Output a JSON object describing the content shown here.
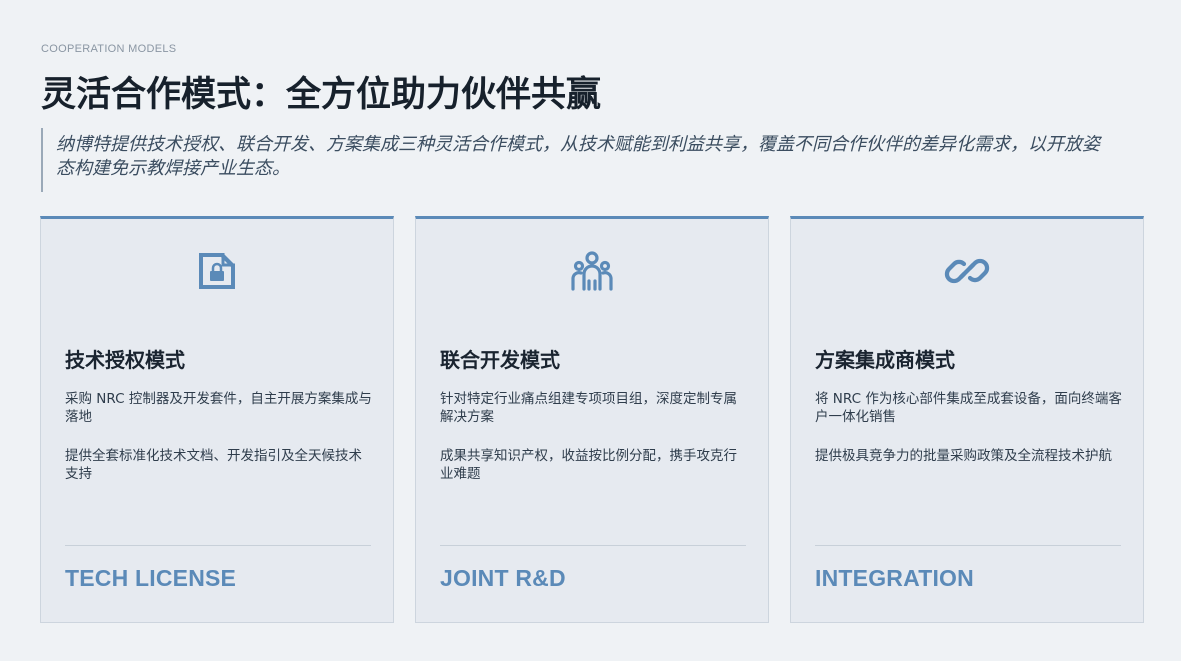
{
  "header": {
    "eyebrow": "COOPERATION MODELS",
    "title": "灵活合作模式：全方位助力伙伴共赢",
    "intro": "纳博特提供技术授权、联合开发、方案集成三种灵活合作模式，从技术赋能到利益共享，覆盖不同合作伙伴的差异化需求，以开放姿态构建免示教焊接产业生态。"
  },
  "colors": {
    "accent": "#5b8ab8",
    "background": "#eff2f5",
    "card": "#e6eaf0"
  },
  "cards": [
    {
      "icon": "license-document-icon",
      "title": "技术授权模式",
      "para1": "采购 NRC 控制器及开发套件，自主开展方案集成与落地",
      "para2": "提供全套标准化技术文档、开发指引及全天候技术支持",
      "tag": "TECH LICENSE"
    },
    {
      "icon": "team-icon",
      "title": "联合开发模式",
      "para1": "针对特定行业痛点组建专项项目组，深度定制专属解决方案",
      "para2": "成果共享知识产权，收益按比例分配，携手攻克行业难题",
      "tag": "JOINT R&D"
    },
    {
      "icon": "link-icon",
      "title": "方案集成商模式",
      "para1": "将 NRC 作为核心部件集成至成套设备，面向终端客户一体化销售",
      "para2": "提供极具竞争力的批量采购政策及全流程技术护航",
      "tag": "INTEGRATION"
    }
  ]
}
